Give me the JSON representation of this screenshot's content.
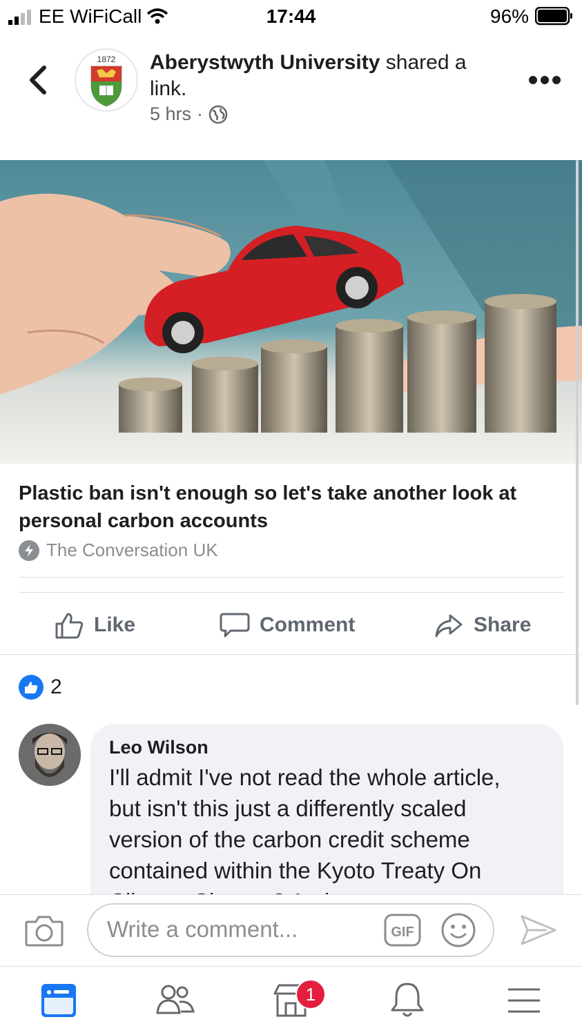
{
  "status_bar": {
    "carrier": "EE WiFiCall",
    "time": "17:44",
    "battery": "96%"
  },
  "post": {
    "logo_year": "1872",
    "author": "Aberystwyth University",
    "action": " shared a link.",
    "time": "5 hrs",
    "dot": "·"
  },
  "link": {
    "title": "Plastic ban isn't enough so let's take another look at personal carbon accounts",
    "source": "The Conversation UK"
  },
  "actions": {
    "like": "Like",
    "comment": "Comment",
    "share": "Share"
  },
  "reactions": {
    "count": "2"
  },
  "comment": {
    "author": "Leo Wilson",
    "text": "I'll admit I've not read the whole article, but isn't this just a differently scaled version of the carbon credit scheme contained within the Kyoto Treaty On Climate Change? At the"
  },
  "composer": {
    "placeholder": "Write a comment...",
    "gif": "GIF"
  },
  "tabbar": {
    "marketplace_badge": "1"
  },
  "colors": {
    "brand_blue": "#1877f2",
    "badge_red": "#e41e3f",
    "text_gray": "#65676b"
  }
}
